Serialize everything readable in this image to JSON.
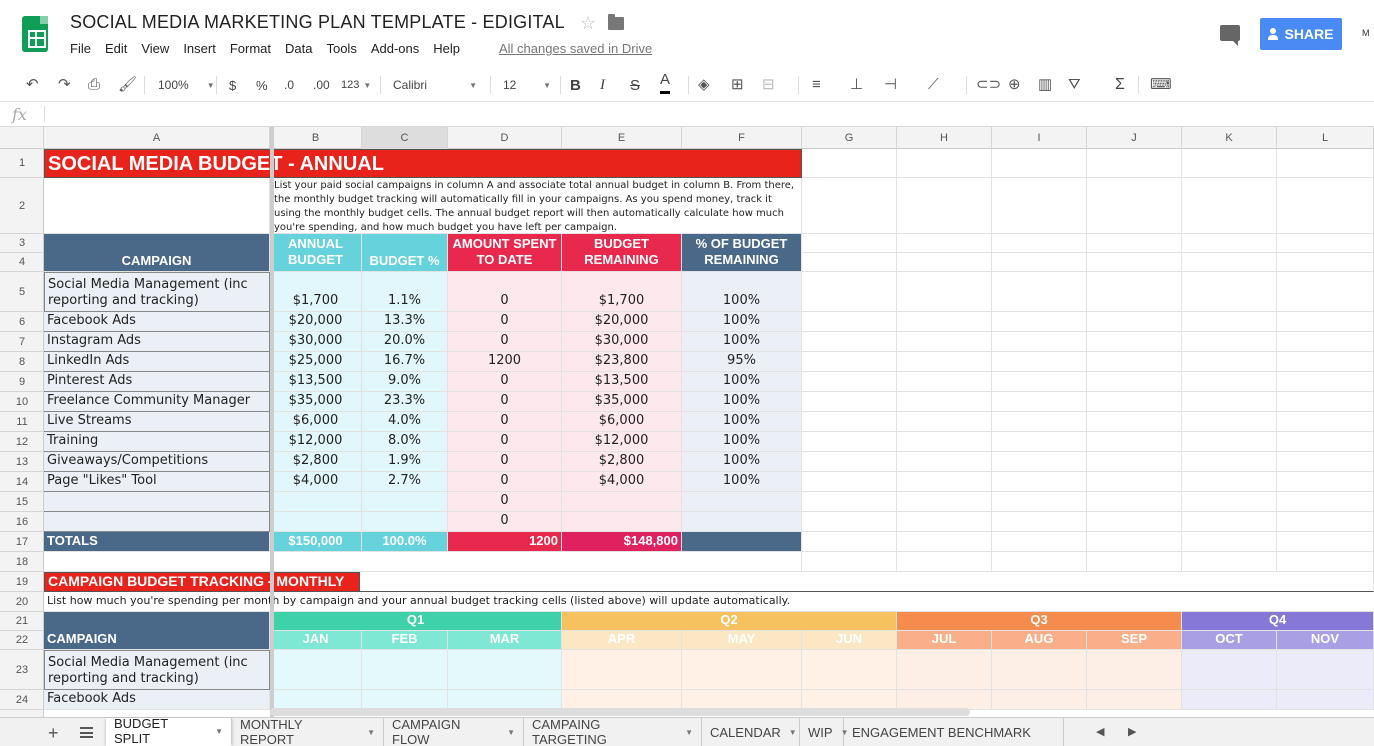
{
  "header": {
    "title": "SOCIAL MEDIA MARKETING PLAN TEMPLATE - EDIGITAL",
    "menu": [
      "File",
      "Edit",
      "View",
      "Insert",
      "Format",
      "Data",
      "Tools",
      "Add-ons",
      "Help"
    ],
    "saved_status": "All changes saved in Drive",
    "share_label": "SHARE",
    "account": "M"
  },
  "toolbar": {
    "zoom": "100%",
    "currency": "$",
    "percent": "%",
    "dec_decrease": ".0",
    "dec_increase": ".00",
    "format_more": "123",
    "font": "Calibri",
    "font_size": "12",
    "bold": "B",
    "italic": "I",
    "strike": "S",
    "text_color": "A",
    "sum": "Σ"
  },
  "formula_bar": {
    "label": "fx",
    "value": ""
  },
  "columns": [
    "A",
    "B",
    "C",
    "D",
    "E",
    "F",
    "G",
    "H",
    "I",
    "J",
    "K",
    "L"
  ],
  "rows": [
    "1",
    "2",
    "3",
    "4",
    "5",
    "6",
    "7",
    "8",
    "9",
    "10",
    "11",
    "12",
    "13",
    "14",
    "15",
    "16",
    "17",
    "18",
    "19",
    "20",
    "21",
    "22",
    "23",
    "24"
  ],
  "sheet": {
    "budget_title": "SOCIAL MEDIA BUDGET - ANNUAL",
    "intro": "List your paid social campaigns in column A and associate total annual budget in column B. From there, the monthly budget tracking will automatically fill in your campaigns. As you spend money, track it using the monthly budget cells. The annual budget report will then automatically calculate how much you're spending, and how much budget you have left per campaign.",
    "headers": {
      "campaign": "CAMPAIGN",
      "annual1": "ANNUAL",
      "annual2": "BUDGET",
      "pct": "BUDGET %",
      "spent1": "AMOUNT SPENT",
      "spent2": "TO DATE",
      "remaining1": "BUDGET",
      "remaining2": "REMAINING",
      "pctrem1": "% OF BUDGET",
      "pctrem2": "REMAINING"
    },
    "campaigns": [
      {
        "name1": "Social Media Management (inc",
        "name2": "reporting and tracking)",
        "budget": "$1,700",
        "pct": "1.1%",
        "spent": "0",
        "remaining": "$1,700",
        "pct_remaining": "100%"
      },
      {
        "name": "Facebook Ads",
        "budget": "$20,000",
        "pct": "13.3%",
        "spent": "0",
        "remaining": "$20,000",
        "pct_remaining": "100%"
      },
      {
        "name": "Instagram Ads",
        "budget": "$30,000",
        "pct": "20.0%",
        "spent": "0",
        "remaining": "$30,000",
        "pct_remaining": "100%"
      },
      {
        "name": "LinkedIn Ads",
        "budget": "$25,000",
        "pct": "16.7%",
        "spent": "1200",
        "remaining": "$23,800",
        "pct_remaining": "95%"
      },
      {
        "name": "Pinterest Ads",
        "budget": "$13,500",
        "pct": "9.0%",
        "spent": "0",
        "remaining": "$13,500",
        "pct_remaining": "100%"
      },
      {
        "name": "Freelance Community Manager",
        "budget": "$35,000",
        "pct": "23.3%",
        "spent": "0",
        "remaining": "$35,000",
        "pct_remaining": "100%"
      },
      {
        "name": "Live Streams",
        "budget": "$6,000",
        "pct": "4.0%",
        "spent": "0",
        "remaining": "$6,000",
        "pct_remaining": "100%"
      },
      {
        "name": "Training",
        "budget": "$12,000",
        "pct": "8.0%",
        "spent": "0",
        "remaining": "$12,000",
        "pct_remaining": "100%"
      },
      {
        "name": "Giveaways/Competitions",
        "budget": "$2,800",
        "pct": "1.9%",
        "spent": "0",
        "remaining": "$2,800",
        "pct_remaining": "100%"
      },
      {
        "name": "Page \"Likes\" Tool",
        "budget": "$4,000",
        "pct": "2.7%",
        "spent": "0",
        "remaining": "$4,000",
        "pct_remaining": "100%"
      },
      {
        "name": "",
        "budget": "",
        "pct": "",
        "spent": "0",
        "remaining": "",
        "pct_remaining": ""
      },
      {
        "name": "",
        "budget": "",
        "pct": "",
        "spent": "0",
        "remaining": "",
        "pct_remaining": ""
      }
    ],
    "totals": {
      "label": "TOTALS",
      "budget": "$150,000",
      "pct": "100.0%",
      "spent": "1200",
      "remaining": "$148,800"
    },
    "tracking_title": "CAMPAIGN BUDGET TRACKING - MONTHLY",
    "tracking_intro": "List how much you're spending per month  by campaign and your annual budget tracking cells (listed above) will update automatically.",
    "quarters": [
      "Q1",
      "Q2",
      "Q3",
      "Q4"
    ],
    "months": [
      "JAN",
      "FEB",
      "MAR",
      "APR",
      "MAY",
      "JUN",
      "JUL",
      "AUG",
      "SEP",
      "OCT",
      "NOV"
    ],
    "tracking_campaign": "CAMPAIGN",
    "tracking_row1a": "Social Media Management (inc",
    "tracking_row1b": "reporting and tracking)",
    "tracking_row2": "Facebook Ads"
  },
  "tabs": [
    "BUDGET SPLIT",
    "MONTHLY REPORT",
    "CAMPAIGN FLOW",
    "CAMPAING TARGETING",
    "CALENDAR",
    "WIP",
    "ENGAGEMENT BENCHMARK"
  ],
  "colors": {
    "title_red": "#e8231c",
    "header_navy": "#4a6888",
    "header_teal": "#66d3dc",
    "header_pink": "#e8284d",
    "q1": "#3fd1a8",
    "q2": "#f6c15f",
    "q3": "#f58b4c",
    "q4": "#8578d6",
    "share_blue": "#4a8af4"
  }
}
